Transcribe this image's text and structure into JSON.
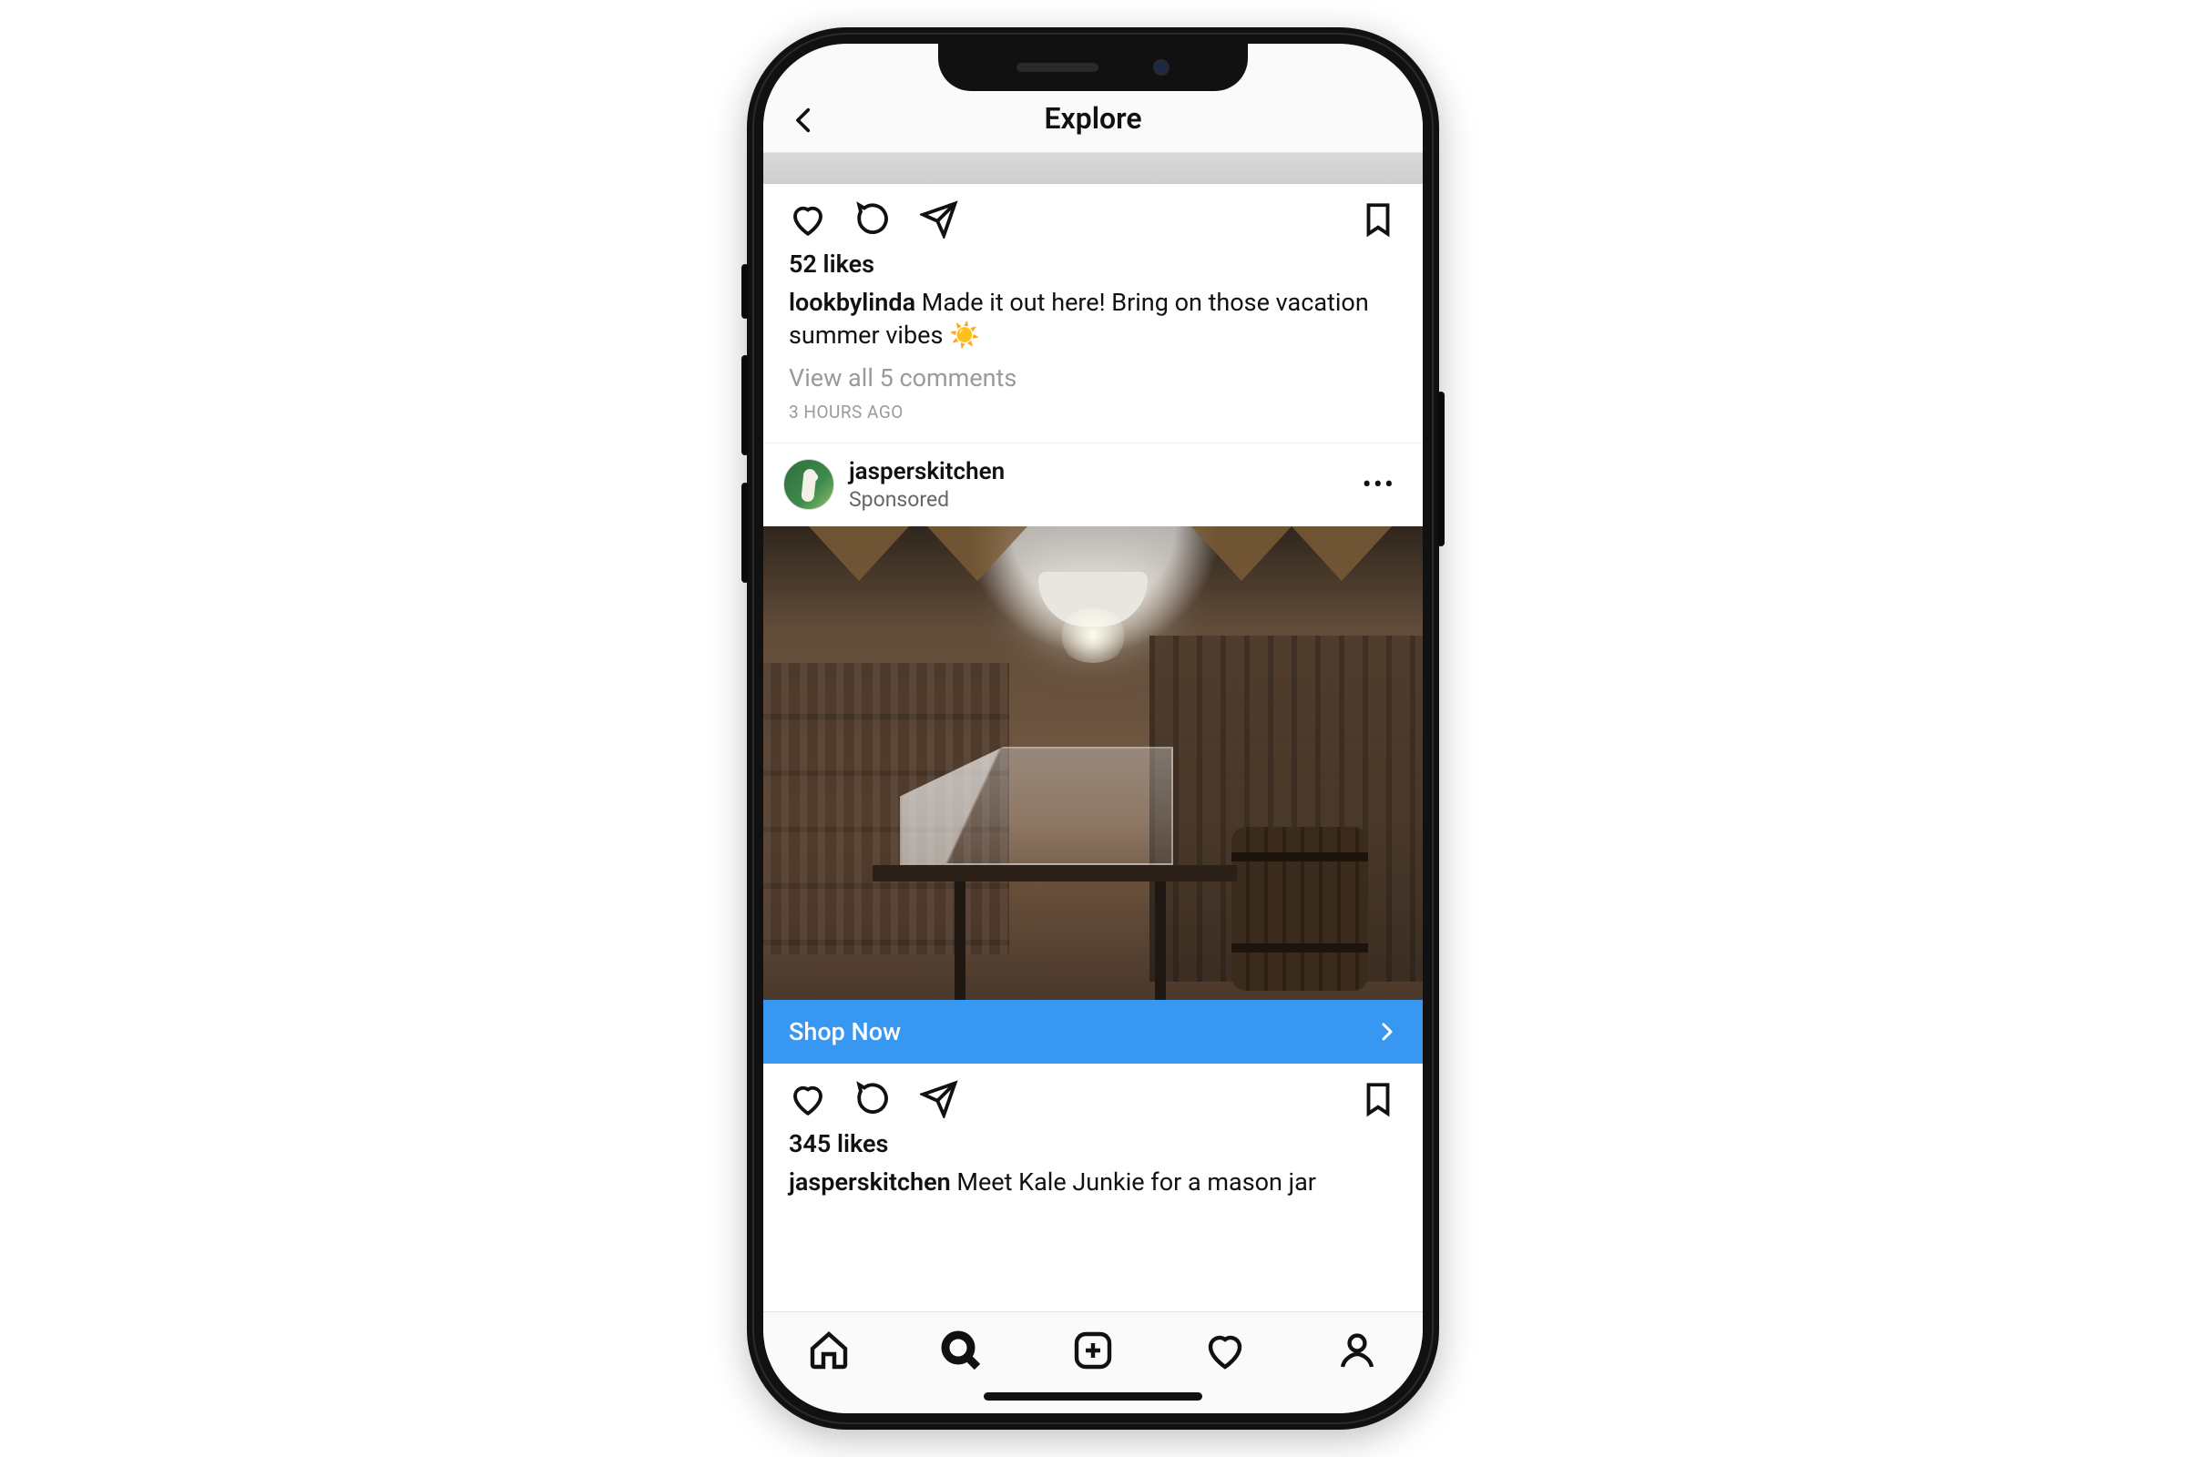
{
  "header": {
    "title": "Explore"
  },
  "post1": {
    "likes": "52 likes",
    "username": "lookbylinda",
    "caption": "Made it out here! Bring on those vacation summer vibes ☀️",
    "view_comments": "View all 5 comments",
    "timestamp": "3 HOURS AGO"
  },
  "post2": {
    "username": "jasperskitchen",
    "subtitle": "Sponsored",
    "cta_label": "Shop Now",
    "likes": "345 likes",
    "caption_user": "jasperskitchen",
    "caption_text": "Meet Kale Junkie for a mason jar"
  },
  "colors": {
    "cta_bg": "#3897f0"
  }
}
